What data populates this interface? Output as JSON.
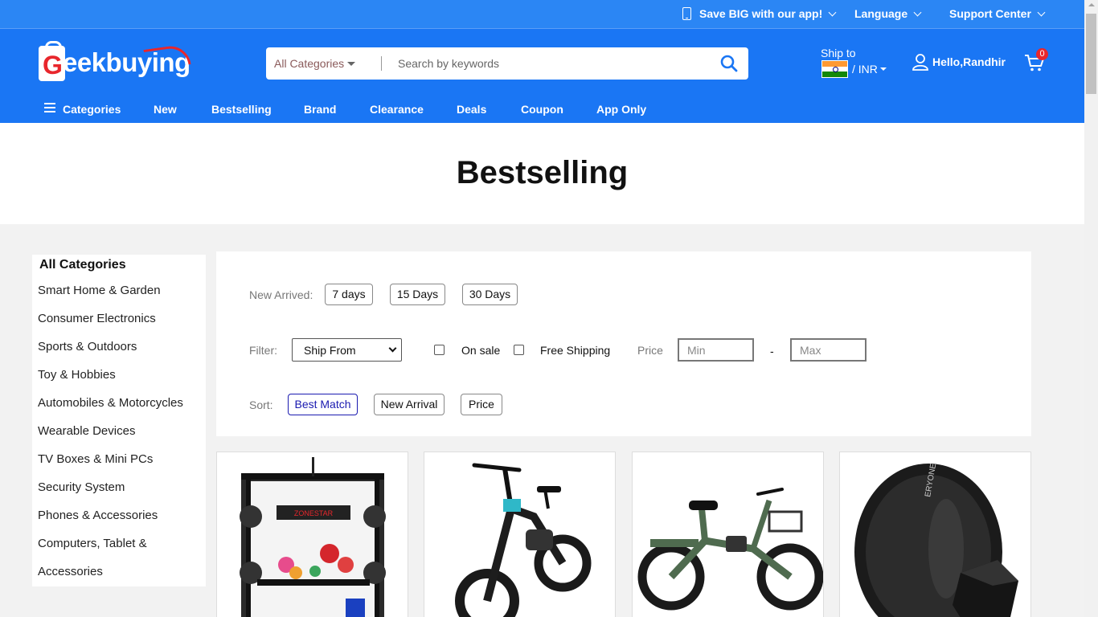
{
  "topbar": {
    "app_promo": "Save BIG with our app!",
    "language": "Language",
    "support": "Support Center"
  },
  "header": {
    "logo_letter": "G",
    "logo_text": "eekbuying",
    "search": {
      "category": "All Categories",
      "placeholder": "Search by keywords"
    },
    "ship_to": "Ship to",
    "currency": "/ INR",
    "greeting": "Hello,Randhir",
    "cart_count": "0"
  },
  "nav": [
    "Categories",
    "New",
    "Bestselling",
    "Brand",
    "Clearance",
    "Deals",
    "Coupon",
    "App Only"
  ],
  "page_title": "Bestselling",
  "sidebar": {
    "heading": "All Categories",
    "items": [
      "Smart Home & Garden",
      "Consumer Electronics",
      "Sports & Outdoors",
      "Toy & Hobbies",
      "Automobiles & Motorcycles",
      "Wearable Devices",
      "TV Boxes & Mini PCs",
      "Security System",
      "Phones & Accessories",
      "Computers, Tablet &",
      "Accessories"
    ]
  },
  "filters": {
    "new_arrived_label": "New Arrived:",
    "days": [
      "7 days",
      "15 Days",
      "30 Days"
    ],
    "filter_label": "Filter:",
    "ship_from": "Ship From",
    "on_sale": "On sale",
    "free_shipping": "Free Shipping",
    "price_label": "Price",
    "min_placeholder": "Min",
    "dash": "-",
    "max_placeholder": "Max",
    "sort_label": "Sort:",
    "sort_options": [
      "Best Match",
      "New Arrival",
      "Price"
    ],
    "sort_active": "Best Match"
  },
  "products": [
    {
      "image": "3d-printer",
      "brand_text": "ZONESTAR"
    },
    {
      "image": "folding-ebike"
    },
    {
      "image": "cargo-ebike"
    },
    {
      "image": "filament-spool",
      "brand_text": "ERYONE"
    }
  ],
  "colors": {
    "topbar": "#2b86f4",
    "header": "#1a76f4",
    "logo_red": "#e8262c",
    "sort_active": "#1a1ab0"
  }
}
